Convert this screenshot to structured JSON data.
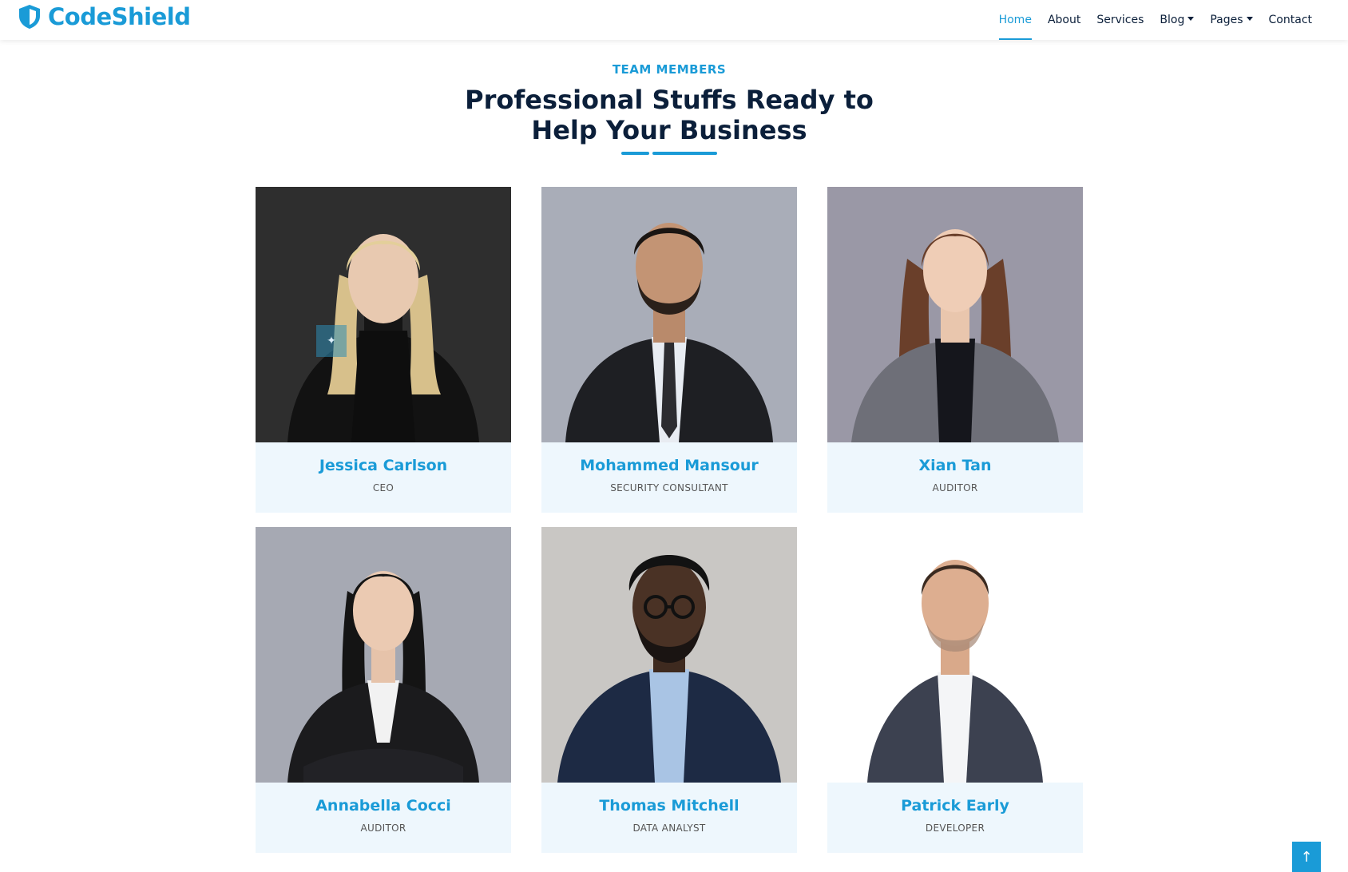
{
  "brand": {
    "name": "CodeShield",
    "icon": "shield-icon",
    "color": "#1a9bd7"
  },
  "nav": {
    "items": [
      {
        "label": "Home",
        "active": true
      },
      {
        "label": "About"
      },
      {
        "label": "Services"
      },
      {
        "label": "Blog",
        "dropdown": true
      },
      {
        "label": "Pages",
        "dropdown": true
      },
      {
        "label": "Contact"
      }
    ]
  },
  "section": {
    "eyebrow": "TEAM MEMBERS",
    "heading_line1": "Professional Stuffs Ready to",
    "heading_line2": "Help Your Business"
  },
  "team": [
    {
      "name": "Jessica Carlson",
      "role": "CEO",
      "social_icon": "twitter-icon"
    },
    {
      "name": "Mohammed Mansour",
      "role": "SECURITY CONSULTANT"
    },
    {
      "name": "Xian Tan",
      "role": "AUDITOR"
    },
    {
      "name": "Annabella Cocci",
      "role": "AUDITOR"
    },
    {
      "name": "Thomas Mitchell",
      "role": "DATA ANALYST"
    },
    {
      "name": "Patrick Early",
      "role": "DEVELOPER"
    }
  ],
  "back_to_top": {
    "icon": "arrow-up-icon"
  }
}
